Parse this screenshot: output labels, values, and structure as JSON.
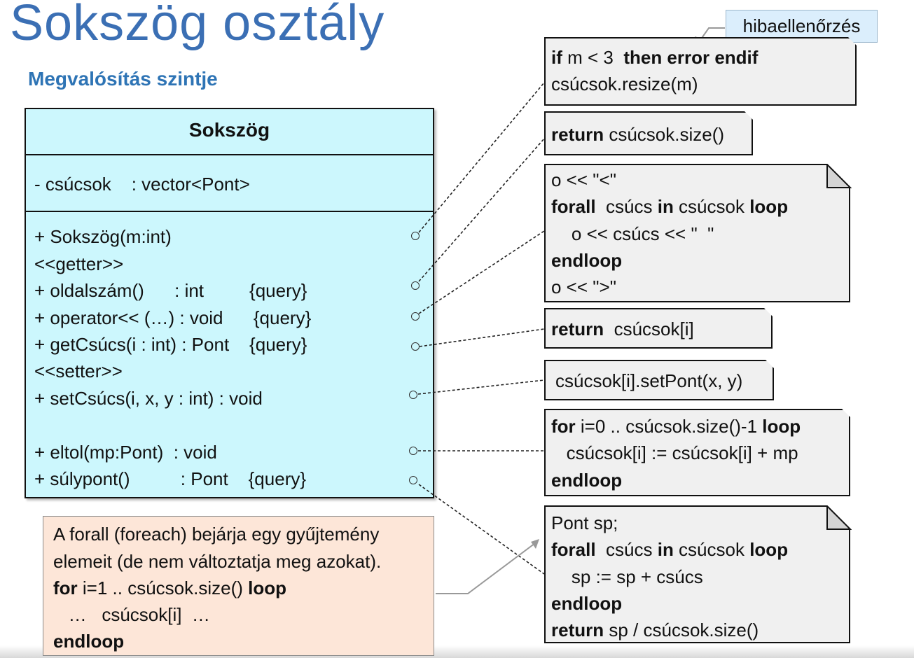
{
  "slide": {
    "title": "Sokszög osztály",
    "subtitle": "Megvalósítás szintje"
  },
  "uml": {
    "class_name": "Sokszög",
    "attribute": "- csúcsok    : vector<Pont>",
    "members": [
      "+ Sokszög(m:int)",
      "<<getter>>",
      "+ oldalszám()      : int         {query}",
      "+ operator<< (…) : void      {query}",
      "+ getCsúcs(i : int) : Pont    {query}",
      "<<setter>>",
      "+ setCsúcs(i, x, y : int) : void",
      "+ eltol(mp:Pont)  : void",
      "+ súlypont()          : Pont    {query}"
    ]
  },
  "callout": {
    "label": "hibaellenőrzés"
  },
  "notes": {
    "constructor": {
      "kw_if": "if",
      "cond": " m < 3  ",
      "kw_then": "then error endif",
      "line2": "csúcsok.resize(m)"
    },
    "oldalszam": {
      "kw_return": "return",
      "expr": " csúcsok.size()"
    },
    "operator": {
      "l1": "o << \"<\"",
      "l2_kw1": "forall",
      "l2_a": "  csúcs ",
      "l2_kw2": "in",
      "l2_b": " csúcsok ",
      "l2_kw3": "loop",
      "l3": "    o << csúcs << \"  \"",
      "l4_kw": "endloop",
      "l5": "o << \">\""
    },
    "getcsucs": {
      "kw_return": "return",
      "expr": "  csúcsok[i]"
    },
    "setcsucs": {
      "expr": "csúcsok[i].setPont(x, y)"
    },
    "eltol": {
      "l1_kw1": "for",
      "l1_a": " i=0 .. csúcsok.size()-1 ",
      "l1_kw2": "loop",
      "l2": "   csúcsok[i] := csúcsok[i] + mp",
      "l3_kw": "endloop"
    },
    "sulypont": {
      "l1": "Pont sp;",
      "l2_kw1": "forall",
      "l2_a": "  csúcs ",
      "l2_kw2": "in",
      "l2_b": " csúcsok ",
      "l2_kw3": "loop",
      "l3": "    sp := sp + csúcs",
      "l4_kw": "endloop",
      "l5_kw": "return",
      "l5_a": " sp / csúcsok.size()"
    }
  },
  "info": {
    "l1": "A forall (foreach) bejárja egy gyűjtemény",
    "l2": "elemeit (de nem változtatja meg azokat).",
    "l3_kw1": "for",
    "l3_a": " i=1 .. csúcsok.size() ",
    "l3_kw2": "loop",
    "l4": "   …   csúcsok[i]  …",
    "l5_kw": "endloop"
  },
  "colors": {
    "title": "#3b6fb4",
    "subtitle": "#2e74b5",
    "class_fill": "#ccf7fd",
    "note_fill": "#f0f0f0",
    "callout_fill": "#dbeefc",
    "info_fill": "#fde6d8"
  }
}
